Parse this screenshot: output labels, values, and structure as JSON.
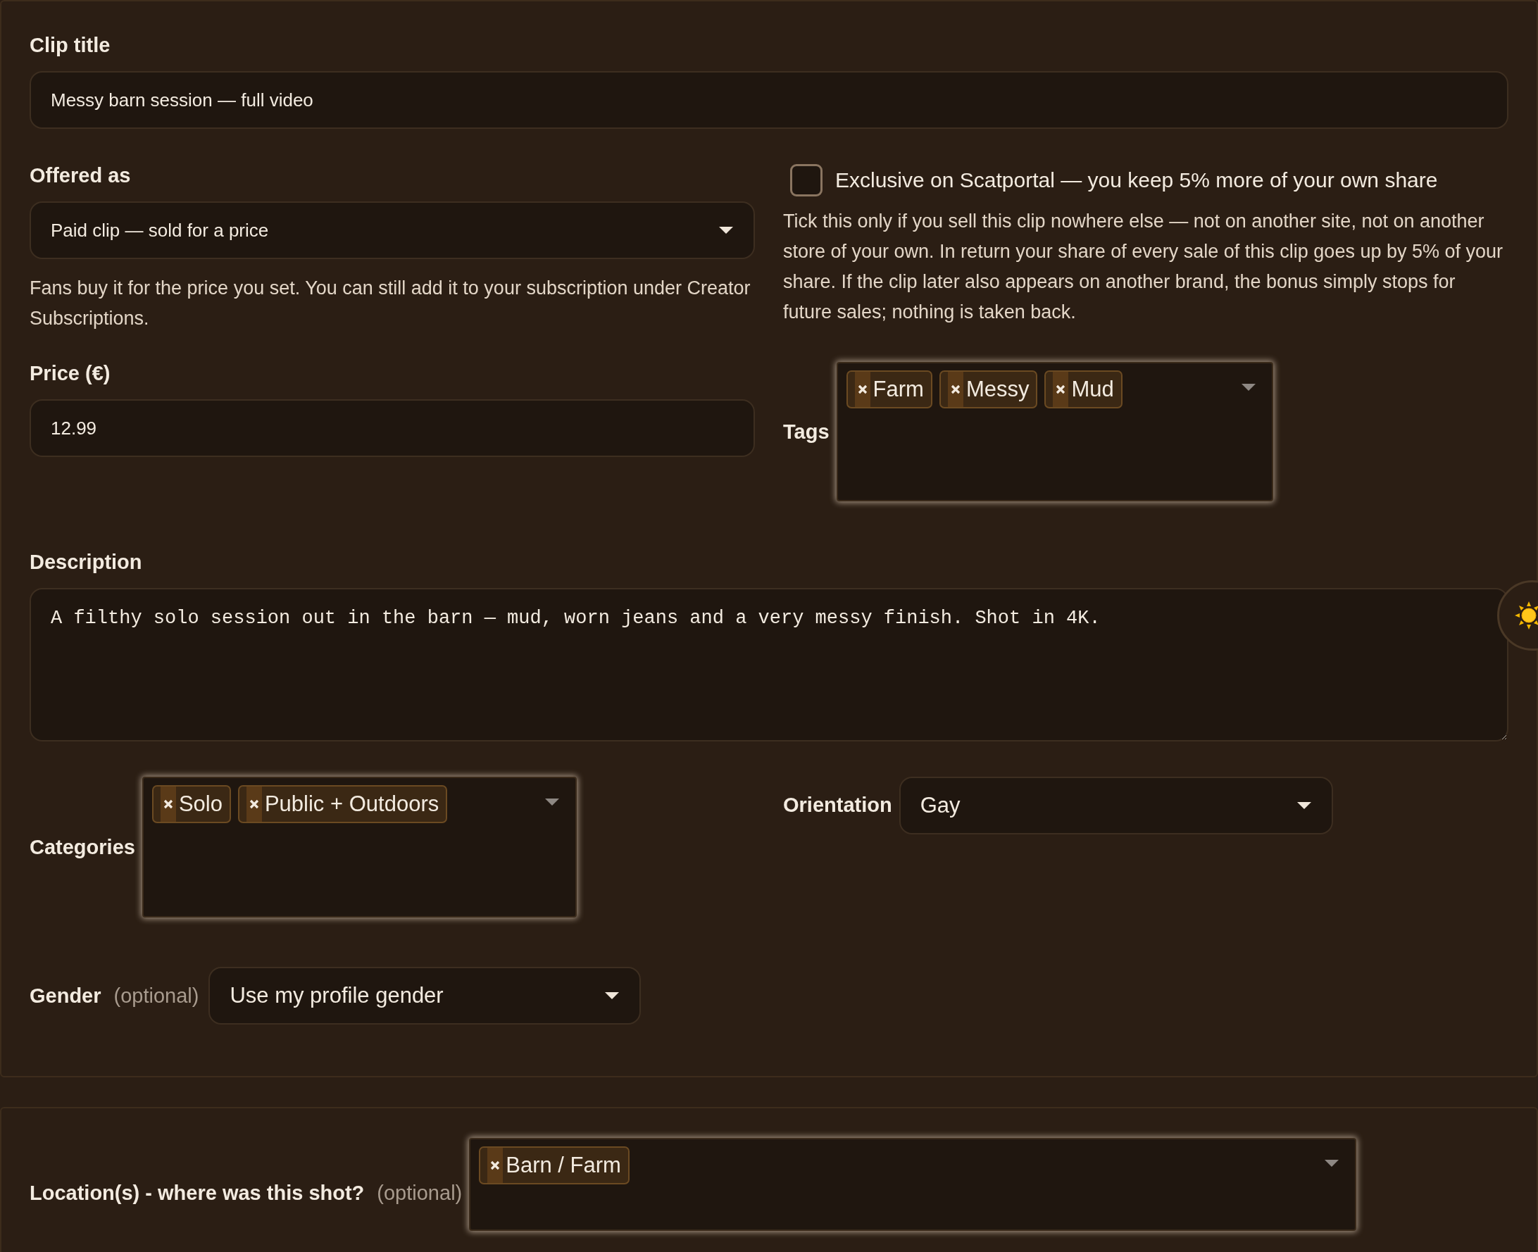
{
  "clip_title": {
    "label": "Clip title",
    "value": "Messy barn session — full video"
  },
  "offered_as": {
    "label": "Offered as",
    "value": "Paid clip — sold for a price",
    "help": "Fans buy it for the price you set. You can still add it to your subscription under Creator Subscriptions."
  },
  "exclusive": {
    "label": "Exclusive on Scatportal — you keep 5% more of your own share",
    "checked": false,
    "help": "Tick this only if you sell this clip nowhere else — not on another site, not on another store of your own. In return your share of every sale of this clip goes up by 5% of your share. If the clip later also appears on another brand, the bonus simply stops for future sales; nothing is taken back."
  },
  "price": {
    "label": "Price (€)",
    "value": "12.99"
  },
  "tags": {
    "label": "Tags",
    "chips": [
      "Farm",
      "Messy",
      "Mud"
    ]
  },
  "description": {
    "label": "Description",
    "value": "A filthy solo session out in the barn — mud, worn jeans and a very messy finish. Shot in 4K."
  },
  "categories": {
    "label": "Categories",
    "chips": [
      "Solo",
      "Public + Outdoors"
    ]
  },
  "orientation": {
    "label": "Orientation",
    "value": "Gay"
  },
  "gender": {
    "label": "Gender",
    "optional": "(optional)",
    "value": "Use my profile gender"
  },
  "location": {
    "label": "Location(s) - where was this shot?",
    "optional": "(optional)",
    "chips": [
      "Barn / Farm"
    ]
  }
}
